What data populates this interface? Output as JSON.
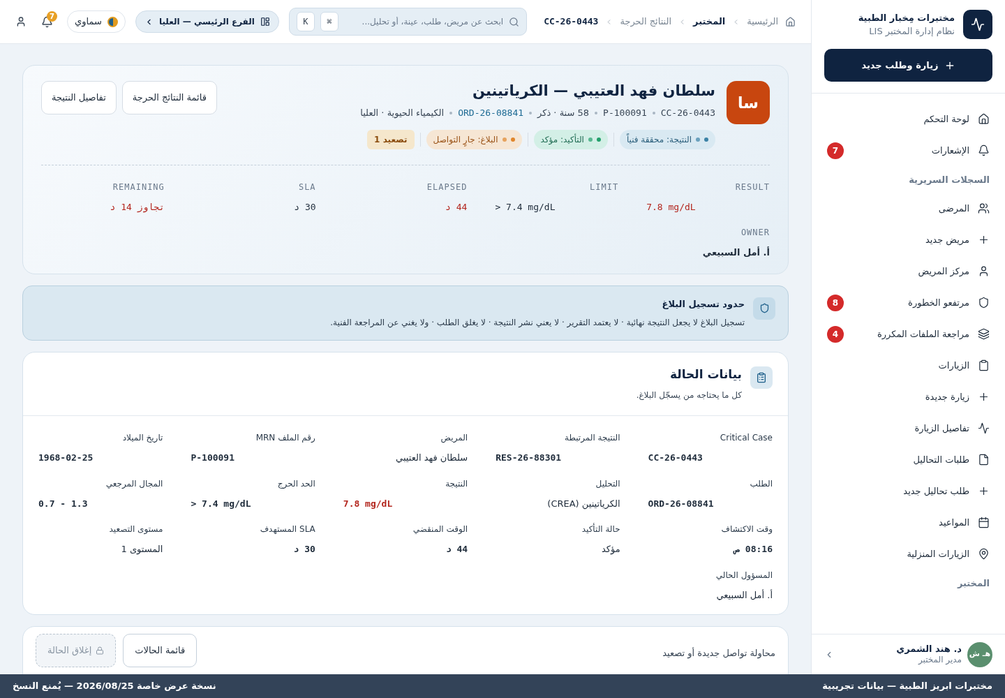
{
  "sidebar": {
    "brand": {
      "title": "مختبرات مِخبار الطبية",
      "subtitle": "نظام إدارة المختبر LIS"
    },
    "primary_button": "زيارة وطلب جديد",
    "groups": [
      {
        "items": [
          {
            "label": "لوحة التحكم"
          },
          {
            "label": "الإشعارات",
            "badge": "7"
          }
        ]
      },
      {
        "title": "السجلات السريرية",
        "items": [
          {
            "label": "المرضى"
          },
          {
            "label": "مريض جديد"
          },
          {
            "label": "مركز المريض"
          },
          {
            "label": "مرتفعو الخطورة",
            "badge": "8"
          },
          {
            "label": "مراجعة الملفات المكررة",
            "badge": "4"
          },
          {
            "label": "الزيارات"
          },
          {
            "label": "زيارة جديدة"
          },
          {
            "label": "تفاصيل الزيارة"
          },
          {
            "label": "طلبات التحاليل"
          },
          {
            "label": "طلب تحاليل جديد"
          },
          {
            "label": "المواعيد"
          },
          {
            "label": "الزيارات المنزلية"
          }
        ]
      },
      {
        "title": "المختبر"
      }
    ],
    "user": {
      "initials": "هـ ش",
      "name": "د. هند الشمري",
      "role": "مدير المختبر"
    }
  },
  "topbar": {
    "breadcrumbs": [
      {
        "label": "الرئيسية",
        "kind": "link"
      },
      {
        "label": "المختبر",
        "kind": "section"
      },
      {
        "label": "النتائج الحرجة",
        "kind": "link"
      },
      {
        "label": "CC-26-0443",
        "kind": "current"
      }
    ],
    "search": {
      "placeholder": "ابحث عن مريض، طلب، عينة، أو تحليل..."
    },
    "shortcut": [
      "⌘",
      "K"
    ],
    "branch": "الفرع الرئيسي — العليا",
    "theme": "سماوي",
    "notification_badge": "7"
  },
  "header": {
    "avatar": "سا",
    "title": "سلطان فهد العتيبي — الكرياتينين",
    "meta": [
      {
        "text": "CC-26-0443",
        "kind": "code"
      },
      {
        "text": "P-100091",
        "kind": "code"
      },
      {
        "text": "58 سنة · ذكر",
        "kind": "text"
      },
      {
        "text": "ORD-26-08841",
        "kind": "link"
      },
      {
        "text": "الكيمياء الحيوية · العليا",
        "kind": "text"
      }
    ],
    "pills": [
      {
        "label": "النتيجة: محققة فنياً",
        "kind": "info"
      },
      {
        "label": "التأكيد: مؤكد",
        "kind": "success"
      },
      {
        "label": "البلاغ: جارٍ التواصل",
        "kind": "warning"
      },
      {
        "label": "تصعيد 1",
        "kind": "escalation"
      }
    ],
    "buttons": [
      "قائمة النتائج الحرجة",
      "تفاصيل النتيجة"
    ],
    "metrics": [
      {
        "label": "RESULT",
        "value": "7.8 mg/dL",
        "danger": true
      },
      {
        "label": "LIMIT",
        "value": "> 7.4 mg/dL",
        "danger": false
      },
      {
        "label": "ELAPSED",
        "value": "44 د",
        "danger": true
      },
      {
        "label": "SLA",
        "value": "30 د",
        "danger": false
      },
      {
        "label": "REMAINING",
        "value": "تجاوز 14 د",
        "danger": true
      }
    ],
    "owner": {
      "label": "OWNER",
      "value": "أ. أمل السبيعي"
    }
  },
  "notice": {
    "title": "حدود تسجيل البلاغ",
    "text": "تسجيل البلاغ لا يجعل النتيجة نهائية · لا يعتمد التقرير · لا يعني نشر النتيجة · لا يغلق الطلب · ولا يغني عن المراجعة الفنية."
  },
  "case_card": {
    "title": "بيانات الحالة",
    "subtitle": "كل ما يحتاجه من يسجّل البلاغ.",
    "fields": [
      {
        "label": "Critical Case",
        "value": "CC-26-0443",
        "kind": "code",
        "danger": false
      },
      {
        "label": "النتيجة المرتبطة",
        "value": "RES-26-88301",
        "kind": "code",
        "danger": false
      },
      {
        "label": "المريض",
        "value": "سلطان فهد العتيبي",
        "kind": "text",
        "danger": false
      },
      {
        "label": "رقم الملف MRN",
        "value": "P-100091",
        "kind": "code",
        "danger": false
      },
      {
        "label": "تاريخ الميلاد",
        "value": "1968-02-25",
        "kind": "code",
        "danger": false
      },
      {
        "label": "الطلب",
        "value": "ORD-26-08841",
        "kind": "code",
        "danger": false
      },
      {
        "label": "التحليل",
        "value": "الكرياتينين (CREA)",
        "kind": "text",
        "danger": false
      },
      {
        "label": "النتيجة",
        "value": "7.8 mg/dL",
        "kind": "code",
        "danger": true
      },
      {
        "label": "الحد الحرج",
        "value": "> 7.4 mg/dL",
        "kind": "code",
        "danger": false
      },
      {
        "label": "المجال المرجعي",
        "value": "0.7 - 1.3",
        "kind": "code",
        "danger": false
      },
      {
        "label": "وقت الاكتشاف",
        "value": "08:16 ص",
        "kind": "code",
        "danger": false
      },
      {
        "label": "حالة التأكيد",
        "value": "مؤكد",
        "kind": "text",
        "danger": false
      },
      {
        "label": "الوقت المنقضي",
        "value": "44 د",
        "kind": "code",
        "danger": false
      },
      {
        "label": "SLA المستهدف",
        "value": "30 د",
        "kind": "code",
        "danger": false
      },
      {
        "label": "مستوى التصعيد",
        "value": "المستوى 1",
        "kind": "text",
        "danger": false
      },
      {
        "label": "المسؤول الحالي",
        "value": "أ. أمل السبيعي",
        "kind": "text",
        "danger": false
      }
    ]
  },
  "action_card": {
    "text": "محاولة تواصل جديدة أو تصعيد",
    "buttons": [
      {
        "label": "قائمة الحالات",
        "disabled": false
      },
      {
        "label": "إغلاق الحالة",
        "disabled": true
      }
    ]
  },
  "demo_banner": {
    "left": "نسخة عرض خاصة 2026/08/25 — يُمنع النسخ",
    "right": "مختبرات ابريز الطبية — بيانات تجريبية"
  }
}
